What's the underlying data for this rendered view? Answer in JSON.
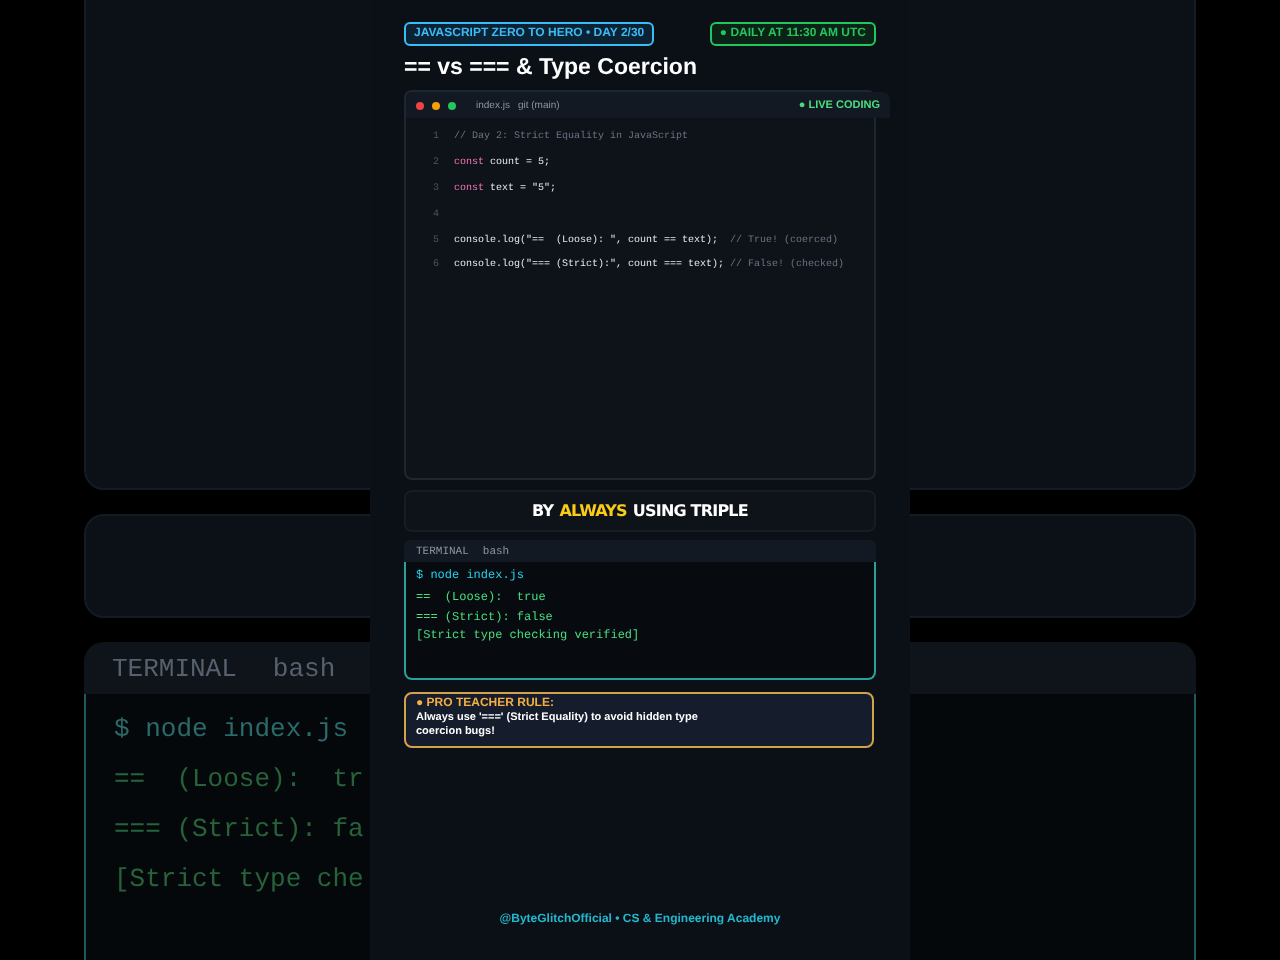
{
  "backdrop": {
    "terminal_tab": "TERMINAL",
    "terminal_shell": "bash",
    "lines": [
      "$ node index.js",
      "==  (Loose):  tr",
      "=== (Strict): fa",
      "[Strict type che"
    ]
  },
  "header": {
    "series_badge": "JAVASCRIPT ZERO TO HERO • DAY 2/30",
    "schedule_badge": "● DAILY AT 11:30 AM UTC",
    "title": "== vs === & Type Coercion"
  },
  "editor": {
    "file": "index.js",
    "branch": "git (main)",
    "live_badge": "● LIVE CODING",
    "lines": [
      {
        "number": "1",
        "segments": [
          {
            "kind": "comment",
            "text": "// Day 2: Strict Equality in JavaScript"
          }
        ]
      },
      {
        "number": "2",
        "segments": [
          {
            "kind": "keyword",
            "text": "const"
          },
          {
            "kind": "plain",
            "text": " count = 5;"
          }
        ]
      },
      {
        "number": "3",
        "segments": [
          {
            "kind": "keyword",
            "text": "const"
          },
          {
            "kind": "plain",
            "text": " text = \"5\";"
          }
        ]
      },
      {
        "number": "4"
      },
      {
        "number": "5",
        "segments": [
          {
            "kind": "plain",
            "text": "console.log(\"==  (Loose): \", count == text);  "
          },
          {
            "kind": "comment",
            "text": "// True! (coerced)"
          }
        ]
      },
      {
        "number": "6",
        "segments": [
          {
            "kind": "plain",
            "text": "console.log(\"=== (Strict):\", count === text); "
          },
          {
            "kind": "comment",
            "text": "// False! (checked)"
          }
        ]
      }
    ]
  },
  "caption": [
    {
      "text": "BY",
      "highlight": false
    },
    {
      "text": "ALWAYS",
      "highlight": true
    },
    {
      "text": "USING TRIPLE",
      "highlight": false
    }
  ],
  "terminal": {
    "tab": "TERMINAL",
    "shell": "bash",
    "lines": [
      {
        "kind": "command",
        "text": "$ node index.js"
      },
      {
        "kind": "output",
        "text": "==  (Loose):  true"
      },
      {
        "kind": "output",
        "text": "=== (Strict): false"
      },
      {
        "kind": "output",
        "text": "[Strict type checking verified]"
      }
    ]
  },
  "rule": {
    "heading": "● PRO TEACHER RULE:",
    "body": "Always use '===' (Strict Equality) to avoid hidden type coercion bugs!"
  },
  "footer": "@ByteGlitchOfficial • CS & Engineering Academy"
}
